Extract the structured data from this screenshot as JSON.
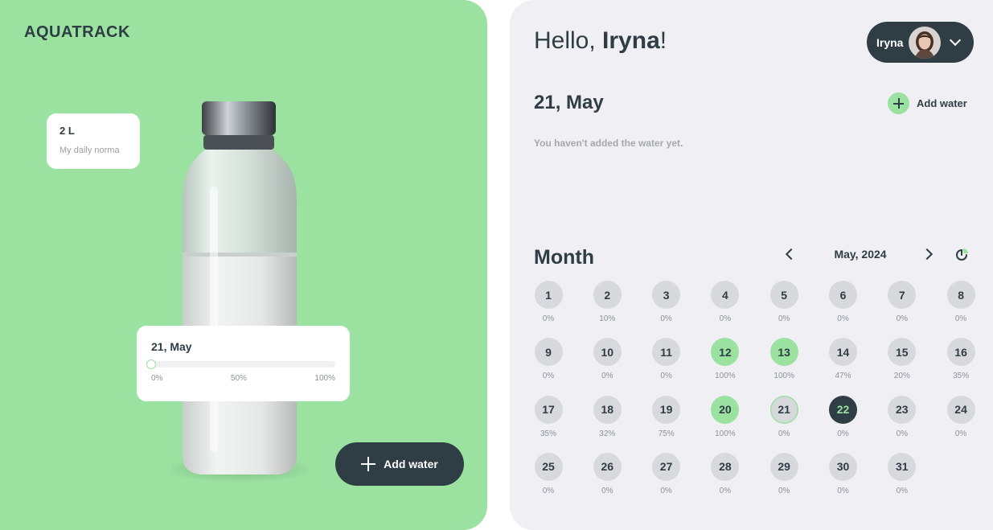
{
  "app": {
    "logo": "AQUATRACK"
  },
  "left": {
    "norma": {
      "value": "2 L",
      "label": "My daily norma"
    },
    "progress": {
      "date": "21, May",
      "percent": 0,
      "ticks": [
        "0%",
        "50%",
        "100%"
      ]
    },
    "add_water_label": "Add water"
  },
  "header": {
    "greeting_prefix": "Hello,",
    "greeting_name": "Iryna",
    "greeting_suffix": "!",
    "user_name": "Iryna"
  },
  "today": {
    "title": "21, May",
    "add_water_label": "Add water",
    "empty_message": "You haven't added the water yet."
  },
  "calendar": {
    "title": "Month",
    "month_label": "May, 2024",
    "days": [
      {
        "day": "1",
        "pct": "0%"
      },
      {
        "day": "2",
        "pct": "10%"
      },
      {
        "day": "3",
        "pct": "0%"
      },
      {
        "day": "4",
        "pct": "0%"
      },
      {
        "day": "5",
        "pct": "0%"
      },
      {
        "day": "6",
        "pct": "0%"
      },
      {
        "day": "7",
        "pct": "0%"
      },
      {
        "day": "8",
        "pct": "0%"
      },
      {
        "day": "9",
        "pct": "0%"
      },
      {
        "day": "10",
        "pct": "0%"
      },
      {
        "day": "11",
        "pct": "0%"
      },
      {
        "day": "12",
        "pct": "100%"
      },
      {
        "day": "13",
        "pct": "100%"
      },
      {
        "day": "14",
        "pct": "47%"
      },
      {
        "day": "15",
        "pct": "20%"
      },
      {
        "day": "16",
        "pct": "35%"
      },
      {
        "day": "17",
        "pct": "35%"
      },
      {
        "day": "18",
        "pct": "32%"
      },
      {
        "day": "19",
        "pct": "75%"
      },
      {
        "day": "20",
        "pct": "100%"
      },
      {
        "day": "21",
        "pct": "0%"
      },
      {
        "day": "22",
        "pct": "0%"
      },
      {
        "day": "23",
        "pct": "0%"
      },
      {
        "day": "24",
        "pct": "0%"
      },
      {
        "day": "25",
        "pct": "0%"
      },
      {
        "day": "26",
        "pct": "0%"
      },
      {
        "day": "27",
        "pct": "0%"
      },
      {
        "day": "28",
        "pct": "0%"
      },
      {
        "day": "29",
        "pct": "0%"
      },
      {
        "day": "30",
        "pct": "0%"
      },
      {
        "day": "31",
        "pct": "0%"
      }
    ],
    "today_day": "22",
    "selected_day": "21"
  },
  "colors": {
    "accent": "#9be1a0",
    "dark": "#2f3d44",
    "panel": "#f0eff4",
    "chip": "#d8d9dd"
  },
  "icons": [
    "plus-icon",
    "chevron-down-icon",
    "chevron-left-icon",
    "chevron-right-icon",
    "stats-icon",
    "bottle-image",
    "avatar"
  ]
}
